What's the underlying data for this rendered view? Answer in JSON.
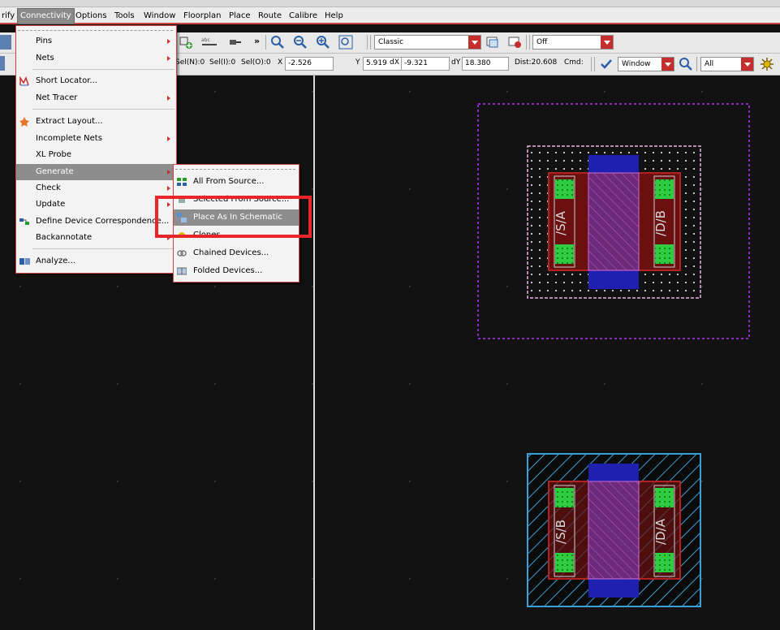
{
  "menubar": {
    "items": [
      "rify",
      "Connectivity",
      "Options",
      "Tools",
      "Window",
      "Floorplan",
      "Place",
      "Route",
      "Calibre",
      "Help"
    ]
  },
  "toolbar1": {
    "view_mode": "Classic",
    "snap_mode": "Off",
    "more": "»"
  },
  "toolbar2": {
    "sel_n": "Sel(N):0",
    "sel_i": "Sel(I):0",
    "sel_o": "Sel(O):0",
    "x_label": "X",
    "x_value": "-2.526",
    "y_label": "Y",
    "y_value": "5.919",
    "dx_label": "dX",
    "dx_value": "-9.321",
    "dy_label": "dY",
    "dy_value": "18.380",
    "dist": "Dist:20.608",
    "cmd": "Cmd:",
    "window_combo": "Window",
    "filter_combo": "All"
  },
  "connectivity_menu": {
    "items": [
      {
        "label": "Pins",
        "has_sub": true,
        "icon": ""
      },
      {
        "label": "Nets",
        "has_sub": true,
        "icon": ""
      },
      {
        "label": "Short Locator...",
        "has_sub": false,
        "icon": "short-locator-icon"
      },
      {
        "label": "Net Tracer",
        "has_sub": true,
        "icon": ""
      },
      {
        "label": "Extract Layout...",
        "has_sub": false,
        "icon": "extract-layout-icon"
      },
      {
        "label": "Incomplete Nets",
        "has_sub": true,
        "icon": ""
      },
      {
        "label": "XL Probe",
        "has_sub": false,
        "icon": ""
      },
      {
        "label": "Generate",
        "has_sub": true,
        "icon": "",
        "highlighted": true
      },
      {
        "label": "Check",
        "has_sub": true,
        "icon": ""
      },
      {
        "label": "Update",
        "has_sub": true,
        "icon": ""
      },
      {
        "label": "Define Device Correspondence...",
        "has_sub": false,
        "icon": "device-correspondence-icon"
      },
      {
        "label": "Backannotate",
        "has_sub": true,
        "icon": ""
      },
      {
        "label": "Analyze...",
        "has_sub": false,
        "icon": "analyze-icon"
      }
    ]
  },
  "generate_submenu": {
    "items": [
      {
        "label": "All From Source...",
        "icon": "all-from-source-icon"
      },
      {
        "label": "Selected From Source...",
        "icon": "selected-from-source-icon"
      },
      {
        "label": "Place As In Schematic",
        "icon": "place-as-schematic-icon",
        "highlighted": true
      },
      {
        "label": "Clones...",
        "icon": "clones-icon"
      },
      {
        "label": "Chained Devices...",
        "icon": "chained-devices-icon"
      },
      {
        "label": "Folded Devices...",
        "icon": "folded-devices-icon"
      }
    ]
  },
  "layout": {
    "device_top": {
      "left_label": "/S/A",
      "right_label": "/D/B"
    },
    "device_bottom": {
      "left_label": "/S/B",
      "right_label": "/D/A"
    }
  },
  "colors": {
    "menu_border": "#c84646",
    "highlight_box": "#e8262a",
    "poly": "#7a2a6a",
    "diffusion": "#b22222",
    "contact": "#2ecc40",
    "metal": "#1f1fb0",
    "implant_purple": "#8e2bbf",
    "implant_blue": "#3aa0d8"
  }
}
